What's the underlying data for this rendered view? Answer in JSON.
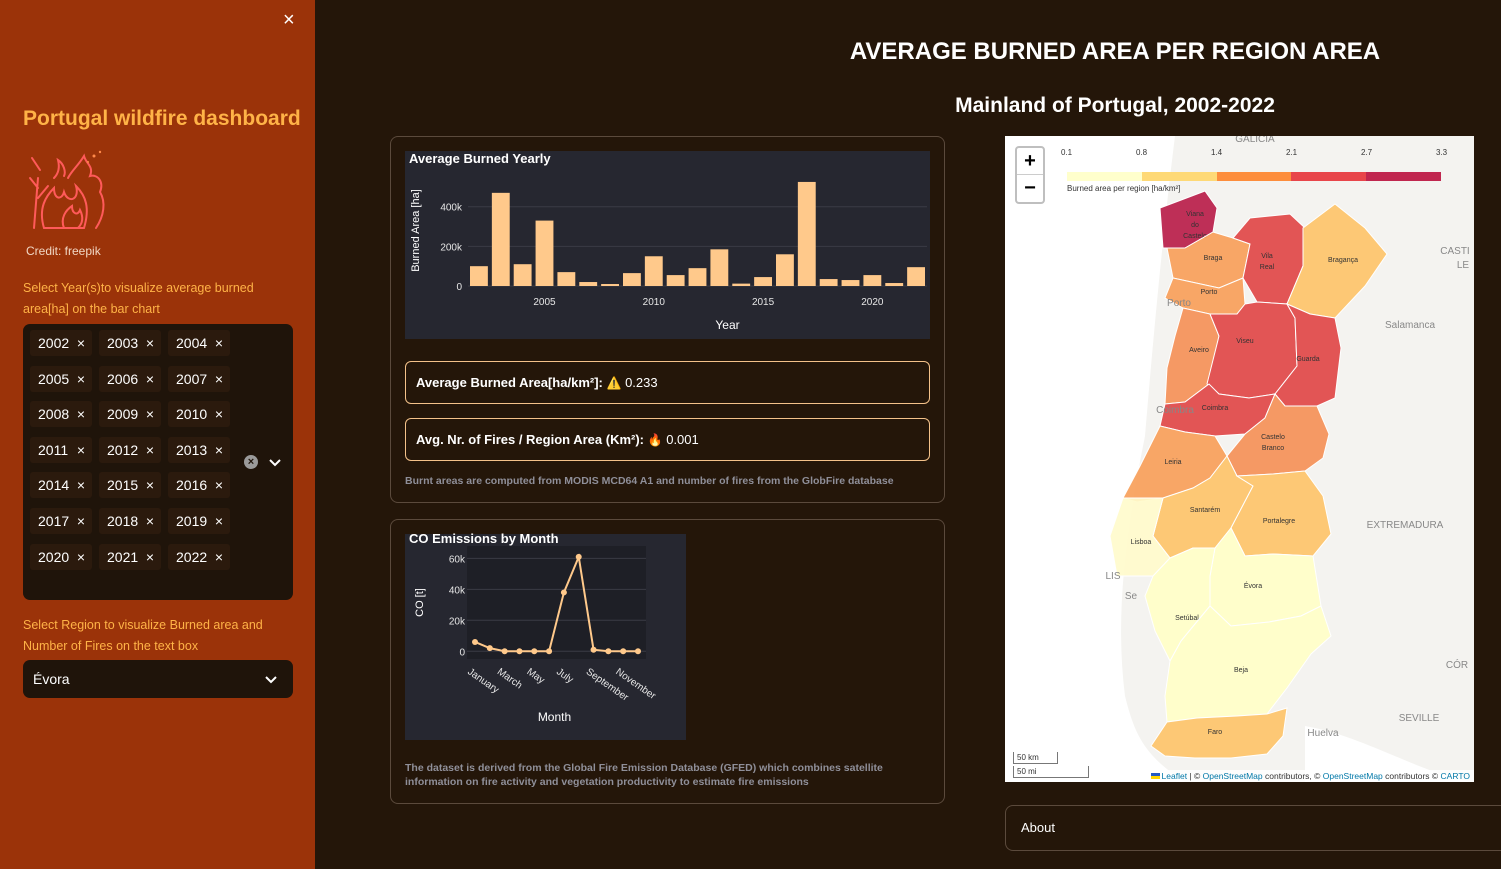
{
  "sidebar": {
    "close_icon": "×",
    "title": "Portugal wildfire dashboard",
    "credit": "Credit: freepik",
    "years_label": "Select Year(s)to visualize average burned area[ha] on the bar chart",
    "years": [
      "2002",
      "2003",
      "2004",
      "2005",
      "2006",
      "2007",
      "2008",
      "2009",
      "2010",
      "2011",
      "2012",
      "2013",
      "2014",
      "2015",
      "2016",
      "2017",
      "2018",
      "2019",
      "2020",
      "2021",
      "2022"
    ],
    "remove_icon": "×",
    "region_label": "Select Region to visualize Burned area and Number of Fires on the text box",
    "region_value": "Évora"
  },
  "header": {
    "title": "AVERAGE BURNED AREA PER REGION AREA",
    "subtitle": "Mainland of Portugal, 2002-2022"
  },
  "metrics": {
    "burned_label": "Average Burned Area[ha/km²]:",
    "burned_icon": "⚠️",
    "burned_value": "0.233",
    "fires_label": "Avg. Nr. of Fires / Region Area (Km²):",
    "fires_icon": "🔥",
    "fires_value": "0.001",
    "caption1": "Burnt areas are computed from MODIS MCD64 A1 and number of fires from the GlobFire database",
    "caption2": "The dataset is derived from the Global Fire Emission Database (GFED) which combines satellite information on fire activity and vegetation productivity to estimate fire emissions"
  },
  "chart_data": [
    {
      "type": "bar",
      "title": "Average Burned Yearly",
      "xlabel": "Year",
      "ylabel": "Burned Area [ha]",
      "color": "#ffc98b",
      "categories": [
        2002,
        2003,
        2004,
        2005,
        2006,
        2007,
        2008,
        2009,
        2010,
        2011,
        2012,
        2013,
        2014,
        2015,
        2016,
        2017,
        2018,
        2019,
        2020,
        2021,
        2022
      ],
      "values": [
        100000,
        470000,
        110000,
        330000,
        70000,
        20000,
        10000,
        65000,
        150000,
        55000,
        90000,
        185000,
        12000,
        45000,
        160000,
        525000,
        35000,
        30000,
        55000,
        15000,
        95000
      ],
      "x_ticks": [
        2005,
        2010,
        2015,
        2020
      ],
      "y_ticks": [
        0,
        200000,
        400000
      ],
      "y_tick_labels": [
        "0",
        "200k",
        "400k"
      ],
      "ylim": [
        0,
        560000
      ]
    },
    {
      "type": "line",
      "title": "CO Emissions by Month",
      "xlabel": "Month",
      "ylabel": "CO [t]",
      "color": "#ffc98b",
      "x": [
        "January",
        "February",
        "March",
        "April",
        "May",
        "June",
        "July",
        "August",
        "September",
        "October",
        "November",
        "December"
      ],
      "x_tick_labels": [
        "January",
        "March",
        "May",
        "July",
        "September",
        "November"
      ],
      "values": [
        6000,
        2000,
        0,
        0,
        0,
        0,
        38000,
        61000,
        1000,
        0,
        0,
        0
      ],
      "y_ticks": [
        0,
        20000,
        40000,
        60000
      ],
      "y_tick_labels": [
        "0",
        "20k",
        "40k",
        "60k"
      ],
      "ylim": [
        -5000,
        68000
      ]
    }
  ],
  "map": {
    "zoom_in": "+",
    "zoom_out": "−",
    "legend_title": "Burned area per region [ha/km²]",
    "legend_ticks": [
      "0.1",
      "0.8",
      "1.4",
      "2.1",
      "2.7",
      "3.3"
    ],
    "legend_colors": [
      "#ffffcc",
      "#fed976",
      "#fd8d3c",
      "#e8454a",
      "#c0264f"
    ],
    "regions": [
      {
        "name": "Viana do Castelo",
        "color": "#b81e4a"
      },
      {
        "name": "Braga",
        "color": "#f7a05a"
      },
      {
        "name": "Vila Real",
        "color": "#e04848"
      },
      {
        "name": "Bragança",
        "color": "#fdc46a"
      },
      {
        "name": "Porto",
        "color": "#f7a05a"
      },
      {
        "name": "Aveiro",
        "color": "#f49158"
      },
      {
        "name": "Viseu",
        "color": "#e04848"
      },
      {
        "name": "Guarda",
        "color": "#e04848"
      },
      {
        "name": "Coimbra",
        "color": "#e04848"
      },
      {
        "name": "Castelo Branco",
        "color": "#f49158"
      },
      {
        "name": "Leiria",
        "color": "#f7a05a"
      },
      {
        "name": "Santarém",
        "color": "#fdc46a"
      },
      {
        "name": "Portalegre",
        "color": "#fdc46a"
      },
      {
        "name": "Lisboa",
        "color": "#fffbcc"
      },
      {
        "name": "Évora",
        "color": "#ffffc8"
      },
      {
        "name": "Setúbal",
        "color": "#ffffc8"
      },
      {
        "name": "Beja",
        "color": "#ffffc8"
      },
      {
        "name": "Faro",
        "color": "#fdc46a"
      }
    ],
    "background_labels": [
      "GALICIA",
      "CASTI",
      "LE",
      "Salamanca",
      "EXTREMADURA",
      "CÓR",
      "SEVILLE",
      "Huelva",
      "Porto",
      "LIS",
      "Se",
      "Coimbra"
    ],
    "scale_km": "50 km",
    "scale_mi": "50 mi",
    "attribution_leaflet": "Leaflet",
    "attribution_text1": " | © ",
    "attribution_osm1": "OpenStreetMap",
    "attribution_text2": " contributors, © ",
    "attribution_osm2": "OpenStreetMap",
    "attribution_text3": " contributors © ",
    "attribution_carto": "CARTO"
  },
  "about": {
    "label": "About"
  }
}
